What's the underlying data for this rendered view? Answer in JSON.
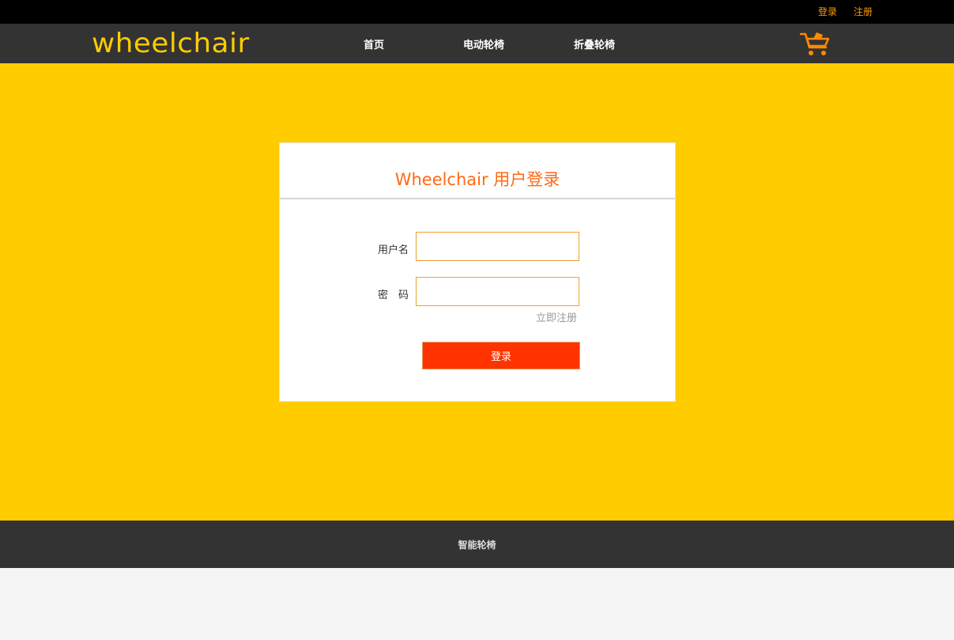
{
  "topbar": {
    "login_label": "登录",
    "register_label": "注册"
  },
  "navbar": {
    "logo_text": "wheelchair",
    "items": [
      {
        "label": "首页"
      },
      {
        "label": "电动轮椅"
      },
      {
        "label": "折叠轮椅"
      }
    ],
    "cart_icon": "shopping-cart-icon"
  },
  "login": {
    "title": "Wheelchair 用户登录",
    "username_label": "用户名",
    "username_value": "",
    "password_label": "密　码",
    "password_value": "",
    "register_link": "立即注册",
    "submit_label": "登录"
  },
  "footer": {
    "text": "智能轮椅"
  },
  "colors": {
    "accent_yellow": "#ffcc00",
    "accent_orange": "#ff6a13",
    "button_red": "#ff3300",
    "dark_bar": "#333333"
  }
}
